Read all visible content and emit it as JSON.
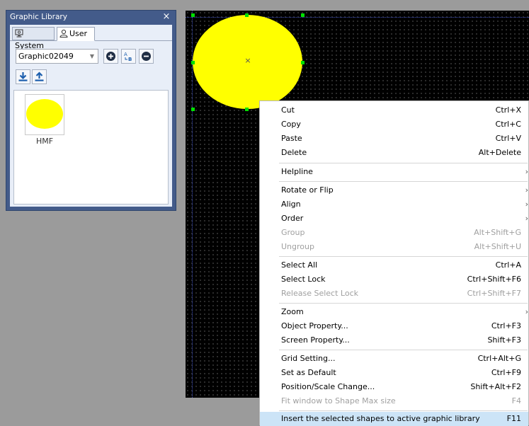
{
  "panel": {
    "title": "Graphic Library",
    "close_glyph": "×",
    "tabs": [
      {
        "label": "System",
        "icon": "system-icon",
        "active": false
      },
      {
        "label": "User",
        "icon": "user-icon",
        "active": true
      }
    ],
    "combo_value": "Graphic02049",
    "toolbar": [
      "add-icon",
      "rename-icon",
      "remove-icon"
    ],
    "transfer": [
      "import-icon",
      "export-icon"
    ],
    "items": [
      {
        "label": "HMF",
        "shape": "ellipse",
        "color": "#ffff00"
      }
    ]
  },
  "canvas": {
    "background": "#000000",
    "shape_color": "#ffff00",
    "handle_color": "#00e000",
    "center_glyph": "×"
  },
  "context_menu": {
    "items": [
      {
        "label": "Cut",
        "shortcut": "Ctrl+X"
      },
      {
        "label": "Copy",
        "shortcut": "Ctrl+C"
      },
      {
        "label": "Paste",
        "shortcut": "Ctrl+V"
      },
      {
        "label": "Delete",
        "shortcut": "Alt+Delete"
      },
      {
        "label": "Helpline",
        "shortcut": "›"
      },
      {
        "label": "Rotate or Flip",
        "shortcut": "›"
      },
      {
        "label": "Align",
        "shortcut": "›"
      },
      {
        "label": "Order",
        "shortcut": "›"
      },
      {
        "label": "Group",
        "shortcut": "Alt+Shift+G",
        "disabled": true
      },
      {
        "label": "Ungroup",
        "shortcut": "Alt+Shift+U",
        "disabled": true
      },
      {
        "label": "Select All",
        "shortcut": "Ctrl+A"
      },
      {
        "label": "Select Lock",
        "shortcut": "Ctrl+Shift+F6"
      },
      {
        "label": "Release Select Lock",
        "shortcut": "Ctrl+Shift+F7",
        "disabled": true
      },
      {
        "label": "Zoom",
        "shortcut": "›"
      },
      {
        "label": "Object Property...",
        "shortcut": "Ctrl+F3"
      },
      {
        "label": "Screen Property...",
        "shortcut": "Shift+F3"
      },
      {
        "label": "Grid Setting...",
        "shortcut": "Ctrl+Alt+G"
      },
      {
        "label": "Set as Default",
        "shortcut": "Ctrl+F9"
      },
      {
        "label": "Position/Scale Change...",
        "shortcut": "Shift+Alt+F2"
      },
      {
        "label": "Fit window to Shape Max size",
        "shortcut": "F4",
        "disabled": true
      },
      {
        "label": "Insert the selected shapes to active graphic library",
        "shortcut": "F11",
        "highlighted": true
      }
    ]
  },
  "colors": {
    "panel_frame": "#435b8a",
    "panel_body": "#e8eef8",
    "menu_highlight": "#cce4f7",
    "button_accent": "#1d5fae"
  }
}
